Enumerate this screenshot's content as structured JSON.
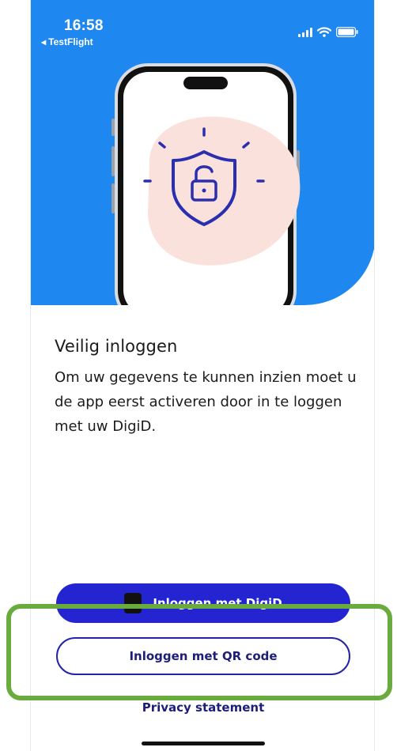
{
  "status_bar": {
    "time": "16:58",
    "back_app": "TestFlight"
  },
  "hero": {
    "background_color": "#1e88f0",
    "illustration_icon": "shield-unlocked-icon"
  },
  "main": {
    "title": "Veilig inloggen",
    "description": "Om uw gegevens te kunnen inzien moet u de app eerst activeren door in te loggen met uw DigiD."
  },
  "actions": {
    "digid_button": "Inloggen met DigiD",
    "qr_button": "Inloggen met QR code",
    "privacy_link": "Privacy statement"
  },
  "colors": {
    "primary_button": "#2424d1",
    "link_text": "#1d1d7a",
    "highlight": "#6aab3e"
  }
}
